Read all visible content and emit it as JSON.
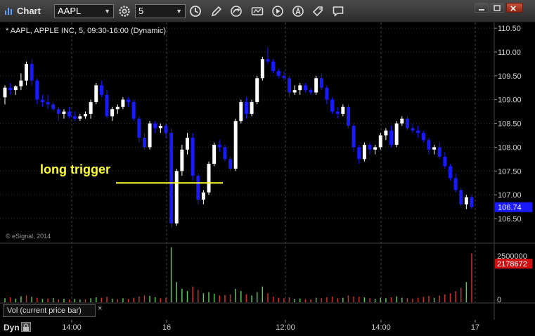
{
  "toolbar": {
    "title": "Chart",
    "symbol": "AAPL",
    "interval": "5",
    "icons": [
      "gear-icon",
      "clock-icon",
      "pencil-icon",
      "redo-icon",
      "studies-icon",
      "play-icon",
      "alert-icon",
      "tag-icon",
      "comment-icon"
    ]
  },
  "header": {
    "label": "* AAPL, APPLE INC, 5, 09:30-16:00 (Dynamic)"
  },
  "copyright": "© eSignal, 2014",
  "annotation": {
    "text": "long trigger",
    "color": "#ffff33",
    "price": 107.25
  },
  "volume_panel": {
    "label": "Vol (current price bar)",
    "close_glyph": "×",
    "scale_max": "2500000",
    "scale_zero": "0",
    "current_value": "2178672"
  },
  "price_axis": {
    "ticks": [
      "110.50",
      "110.00",
      "109.50",
      "109.00",
      "108.50",
      "108.00",
      "107.50",
      "107.00",
      "106.50"
    ],
    "current_price": "106.74"
  },
  "time_axis": {
    "ticks": [
      "14:00",
      "16",
      "12:00",
      "14:00",
      "17"
    ]
  },
  "bottom": {
    "mode": "Dyn"
  },
  "colors": {
    "up": "#ffffff",
    "down": "#1a1aff",
    "vol_up": "#5ec85e",
    "vol_down": "#d03030",
    "current_price_bg": "#1a1aff",
    "current_volume_bg": "#d01010"
  },
  "chart_data": {
    "type": "candlestick",
    "ylim": [
      106.2,
      110.7
    ],
    "candles": [
      [
        109.05,
        109.3,
        108.9,
        109.25
      ],
      [
        109.25,
        109.35,
        109.1,
        109.2
      ],
      [
        109.2,
        109.3,
        109.1,
        109.28
      ],
      [
        109.28,
        109.55,
        109.2,
        109.4
      ],
      [
        109.4,
        109.8,
        109.3,
        109.75
      ],
      [
        109.75,
        109.85,
        109.3,
        109.4
      ],
      [
        109.4,
        109.45,
        108.9,
        109.0
      ],
      [
        109.0,
        109.1,
        108.85,
        108.95
      ],
      [
        108.95,
        109.1,
        108.8,
        108.9
      ],
      [
        108.9,
        108.95,
        108.75,
        108.8
      ],
      [
        108.8,
        108.85,
        108.55,
        108.7
      ],
      [
        108.7,
        108.8,
        108.6,
        108.75
      ],
      [
        108.75,
        108.85,
        108.6,
        108.65
      ],
      [
        108.65,
        108.75,
        108.55,
        108.6
      ],
      [
        108.6,
        108.7,
        108.55,
        108.65
      ],
      [
        108.65,
        108.75,
        108.6,
        108.7
      ],
      [
        108.7,
        109.0,
        108.6,
        108.95
      ],
      [
        108.95,
        109.35,
        108.9,
        109.3
      ],
      [
        109.3,
        109.4,
        109.05,
        109.1
      ],
      [
        109.1,
        109.2,
        108.6,
        108.65
      ],
      [
        108.65,
        108.85,
        108.55,
        108.8
      ],
      [
        108.8,
        108.9,
        108.7,
        108.85
      ],
      [
        108.85,
        109.05,
        108.8,
        109.0
      ],
      [
        109.0,
        109.05,
        108.85,
        108.95
      ],
      [
        108.95,
        109.0,
        108.55,
        108.6
      ],
      [
        108.6,
        108.65,
        108.1,
        108.2
      ],
      [
        108.2,
        108.3,
        107.95,
        108.0
      ],
      [
        108.0,
        108.55,
        107.95,
        108.5
      ],
      [
        108.5,
        108.55,
        108.3,
        108.4
      ],
      [
        108.4,
        108.5,
        108.3,
        108.45
      ],
      [
        108.45,
        108.5,
        108.2,
        108.3
      ],
      [
        108.3,
        108.4,
        106.3,
        106.4
      ],
      [
        106.4,
        107.55,
        106.35,
        107.5
      ],
      [
        107.5,
        108.05,
        107.4,
        107.95
      ],
      [
        107.95,
        108.3,
        107.85,
        108.2
      ],
      [
        108.2,
        108.3,
        107.3,
        107.4
      ],
      [
        107.4,
        107.45,
        106.8,
        106.9
      ],
      [
        106.9,
        107.1,
        106.8,
        107.05
      ],
      [
        107.05,
        107.7,
        107.0,
        107.65
      ],
      [
        107.65,
        108.1,
        107.6,
        108.05
      ],
      [
        108.05,
        108.15,
        107.9,
        108.0
      ],
      [
        108.0,
        108.05,
        107.7,
        107.75
      ],
      [
        107.75,
        107.8,
        107.5,
        107.55
      ],
      [
        107.55,
        108.6,
        107.5,
        108.55
      ],
      [
        108.55,
        109.0,
        108.5,
        108.95
      ],
      [
        108.95,
        109.05,
        108.6,
        108.7
      ],
      [
        108.7,
        109.0,
        108.65,
        108.95
      ],
      [
        108.95,
        109.5,
        108.9,
        109.45
      ],
      [
        109.45,
        109.9,
        109.4,
        109.85
      ],
      [
        109.85,
        110.1,
        109.75,
        109.8
      ],
      [
        109.8,
        109.85,
        109.55,
        109.6
      ],
      [
        109.6,
        109.65,
        109.45,
        109.5
      ],
      [
        109.5,
        109.6,
        109.4,
        109.45
      ],
      [
        109.45,
        109.5,
        109.05,
        109.15
      ],
      [
        109.15,
        109.3,
        109.1,
        109.2
      ],
      [
        109.2,
        109.35,
        109.1,
        109.3
      ],
      [
        109.3,
        109.35,
        109.15,
        109.2
      ],
      [
        109.2,
        109.25,
        109.1,
        109.15
      ],
      [
        109.15,
        109.5,
        109.1,
        109.45
      ],
      [
        109.45,
        109.55,
        109.2,
        109.25
      ],
      [
        109.25,
        109.3,
        108.9,
        109.0
      ],
      [
        109.0,
        109.05,
        108.7,
        108.75
      ],
      [
        108.75,
        108.85,
        108.6,
        108.7
      ],
      [
        108.7,
        108.9,
        108.65,
        108.85
      ],
      [
        108.85,
        108.9,
        108.4,
        108.45
      ],
      [
        108.45,
        108.5,
        107.9,
        108.0
      ],
      [
        108.0,
        108.05,
        107.65,
        107.75
      ],
      [
        107.75,
        108.1,
        107.7,
        108.05
      ],
      [
        108.05,
        108.1,
        107.85,
        107.95
      ],
      [
        107.95,
        108.05,
        107.85,
        108.0
      ],
      [
        108.0,
        108.3,
        107.95,
        108.25
      ],
      [
        108.25,
        108.4,
        108.15,
        108.35
      ],
      [
        108.35,
        108.45,
        108.0,
        108.05
      ],
      [
        108.05,
        108.55,
        108.0,
        108.5
      ],
      [
        108.5,
        108.65,
        108.45,
        108.6
      ],
      [
        108.6,
        108.65,
        108.35,
        108.4
      ],
      [
        108.4,
        108.5,
        108.3,
        108.35
      ],
      [
        108.35,
        108.45,
        108.2,
        108.3
      ],
      [
        108.3,
        108.35,
        108.1,
        108.15
      ],
      [
        108.15,
        108.2,
        107.85,
        107.95
      ],
      [
        107.95,
        108.05,
        107.85,
        108.0
      ],
      [
        108.0,
        108.1,
        107.75,
        107.8
      ],
      [
        107.8,
        107.9,
        107.55,
        107.6
      ],
      [
        107.6,
        107.65,
        107.3,
        107.35
      ],
      [
        107.35,
        107.45,
        107.05,
        107.1
      ],
      [
        107.1,
        107.15,
        106.75,
        106.8
      ],
      [
        106.8,
        107.0,
        106.7,
        106.95
      ],
      [
        106.95,
        107.0,
        106.7,
        106.74
      ]
    ],
    "volume": [
      [
        180000,
        1
      ],
      [
        220000,
        0
      ],
      [
        160000,
        1
      ],
      [
        260000,
        1
      ],
      [
        300000,
        0
      ],
      [
        240000,
        1
      ],
      [
        200000,
        0
      ],
      [
        150000,
        1
      ],
      [
        170000,
        0
      ],
      [
        190000,
        1
      ],
      [
        140000,
        0
      ],
      [
        160000,
        1
      ],
      [
        130000,
        0
      ],
      [
        150000,
        1
      ],
      [
        120000,
        1
      ],
      [
        140000,
        0
      ],
      [
        180000,
        1
      ],
      [
        220000,
        1
      ],
      [
        200000,
        0
      ],
      [
        240000,
        0
      ],
      [
        160000,
        1
      ],
      [
        140000,
        0
      ],
      [
        180000,
        1
      ],
      [
        150000,
        0
      ],
      [
        200000,
        0
      ],
      [
        260000,
        0
      ],
      [
        300000,
        0
      ],
      [
        280000,
        1
      ],
      [
        220000,
        1
      ],
      [
        180000,
        0
      ],
      [
        200000,
        0
      ],
      [
        2450000,
        1
      ],
      [
        900000,
        1
      ],
      [
        600000,
        1
      ],
      [
        500000,
        1
      ],
      [
        700000,
        0
      ],
      [
        550000,
        0
      ],
      [
        400000,
        1
      ],
      [
        450000,
        1
      ],
      [
        380000,
        1
      ],
      [
        300000,
        0
      ],
      [
        320000,
        0
      ],
      [
        350000,
        0
      ],
      [
        600000,
        1
      ],
      [
        500000,
        1
      ],
      [
        350000,
        0
      ],
      [
        300000,
        1
      ],
      [
        450000,
        1
      ],
      [
        700000,
        1
      ],
      [
        400000,
        0
      ],
      [
        250000,
        0
      ],
      [
        200000,
        0
      ],
      [
        180000,
        0
      ],
      [
        220000,
        0
      ],
      [
        150000,
        1
      ],
      [
        170000,
        1
      ],
      [
        140000,
        0
      ],
      [
        130000,
        0
      ],
      [
        200000,
        1
      ],
      [
        180000,
        0
      ],
      [
        220000,
        0
      ],
      [
        250000,
        0
      ],
      [
        180000,
        0
      ],
      [
        200000,
        1
      ],
      [
        300000,
        0
      ],
      [
        260000,
        0
      ],
      [
        240000,
        0
      ],
      [
        220000,
        1
      ],
      [
        180000,
        0
      ],
      [
        160000,
        1
      ],
      [
        200000,
        1
      ],
      [
        180000,
        1
      ],
      [
        220000,
        0
      ],
      [
        260000,
        1
      ],
      [
        200000,
        1
      ],
      [
        180000,
        0
      ],
      [
        160000,
        0
      ],
      [
        200000,
        0
      ],
      [
        240000,
        0
      ],
      [
        280000,
        0
      ],
      [
        200000,
        1
      ],
      [
        300000,
        0
      ],
      [
        350000,
        0
      ],
      [
        400000,
        0
      ],
      [
        500000,
        0
      ],
      [
        650000,
        0
      ],
      [
        900000,
        1
      ],
      [
        2178672,
        0
      ]
    ]
  }
}
